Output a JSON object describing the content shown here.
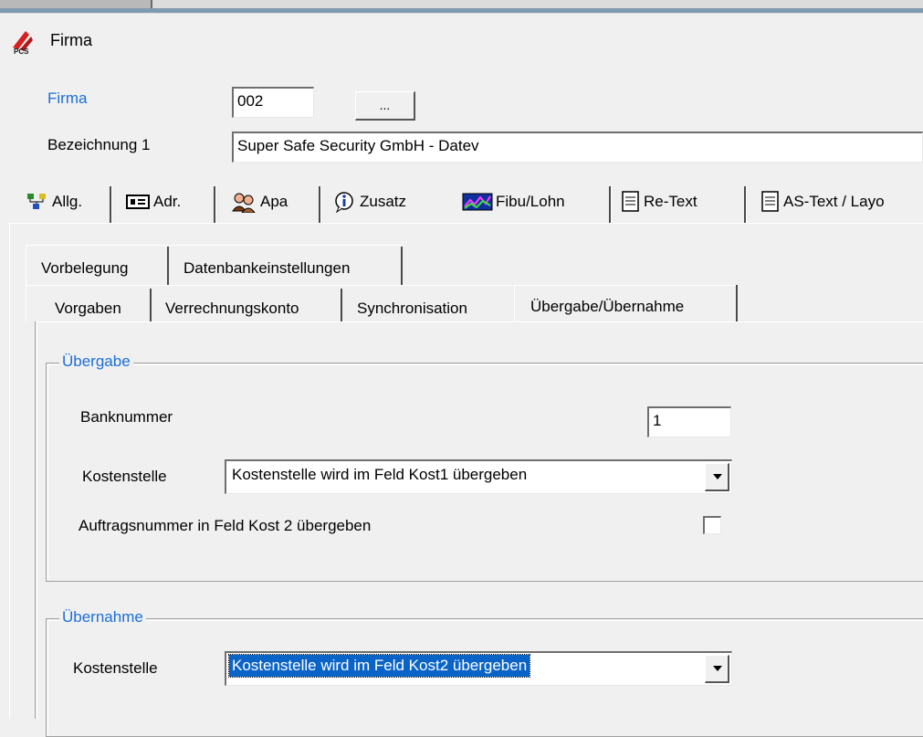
{
  "window": {
    "title": "Firma",
    "app_icon": "pcs-logo-icon"
  },
  "header": {
    "firma_label": "Firma",
    "firma_value": "002",
    "lookup_button": "...",
    "bezeichnung_label": "Bezeichnung 1",
    "bezeichnung_value": "Super Safe Security GmbH - Datev"
  },
  "main_tabs": [
    {
      "label": "Allg.",
      "icon": "org-chart-icon"
    },
    {
      "label": "Adr.",
      "icon": "address-card-icon"
    },
    {
      "label": "Apa",
      "icon": "contacts-icon"
    },
    {
      "label": "Zusatz",
      "icon": "info-icon"
    },
    {
      "label": "Fibu/Lohn",
      "icon": "chart-icon",
      "selected": true
    },
    {
      "label": "Re-Text",
      "icon": "document-icon"
    },
    {
      "label": "AS-Text / Layo",
      "icon": "document-icon"
    }
  ],
  "sub_tabs_row1": [
    "Vorbelegung",
    "Datenbankeinstellungen"
  ],
  "sub_tabs_row2": [
    "Vorgaben",
    "Verrechnungskonto",
    "Synchronisation",
    "Übergabe/Übernahme"
  ],
  "uebergabe": {
    "group_title": "Übergabe",
    "banknummer_label": "Banknummer",
    "banknummer_value": "1",
    "kostenstelle_label": "Kostenstelle",
    "kostenstelle_value": "Kostenstelle wird im Feld Kost1 übergeben",
    "auftragsnummer_label": "Auftragsnummer in Feld Kost 2 übergeben",
    "auftragsnummer_checked": false
  },
  "uebernahme": {
    "group_title": "Übernahme",
    "kostenstelle_label": "Kostenstelle",
    "kostenstelle_value": "Kostenstelle wird im Feld Kost2 übergeben"
  },
  "colors": {
    "accent": "#1c6fd6",
    "selection": "#0a64c8"
  }
}
